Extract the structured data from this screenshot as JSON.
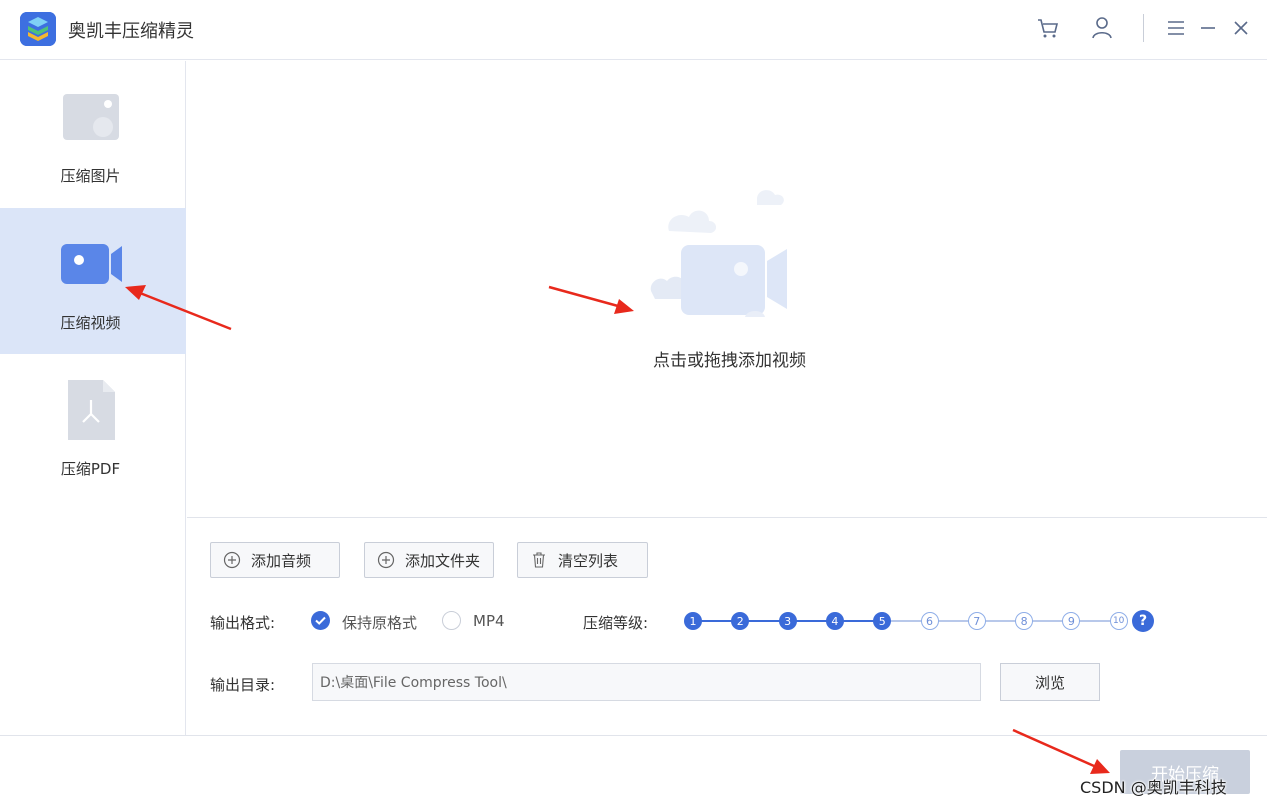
{
  "app": {
    "title": "奥凯丰压缩精灵"
  },
  "titlebar": {
    "icons": [
      "cart-icon",
      "user-icon",
      "menu-icon",
      "minimize-icon",
      "close-icon"
    ]
  },
  "sidebar": {
    "items": [
      {
        "label": "压缩图片",
        "icon": "image-icon",
        "active": false
      },
      {
        "label": "压缩视频",
        "icon": "video-icon",
        "active": true
      },
      {
        "label": "压缩PDF",
        "icon": "pdf-icon",
        "active": false
      }
    ]
  },
  "drop": {
    "text": "点击或拖拽添加视频"
  },
  "toolbar": {
    "add_audio": "添加音频",
    "add_folder": "添加文件夹",
    "clear_list": "清空列表"
  },
  "output_format": {
    "label": "输出格式:",
    "options": [
      {
        "label": "保持原格式",
        "checked": true
      },
      {
        "label": "MP4",
        "checked": false
      }
    ]
  },
  "compression": {
    "label": "压缩等级:",
    "levels": [
      "1",
      "2",
      "3",
      "4",
      "5",
      "6",
      "7",
      "8",
      "9",
      "10"
    ],
    "selected": 5,
    "help": "?"
  },
  "output_dir": {
    "label": "输出目录:",
    "value": "D:\\桌面\\File Compress Tool\\",
    "browse": "浏览"
  },
  "footer": {
    "start": "开始压缩"
  },
  "watermark": "CSDN @奥凯丰科技",
  "colors": {
    "accent": "#3a6ad9",
    "active_bg": "#dbe5f8",
    "arrow": "#e8291c"
  }
}
